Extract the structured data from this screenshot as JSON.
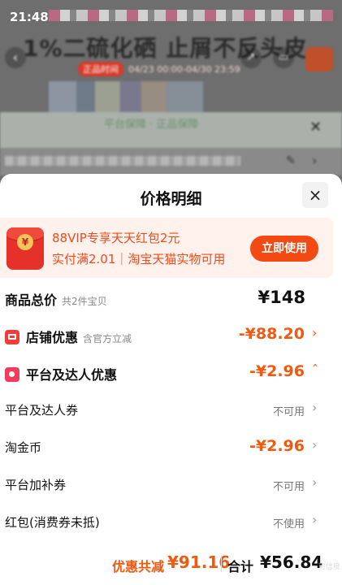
{
  "status_bar": {
    "time": "21:48"
  },
  "background": {
    "title": "1%二硫化硒 止屑不反头皮",
    "promo_pill": "正品时间",
    "promo_dates": "04/23 00:00-04/30 23:59",
    "guarantee_text": "平台保障 · 正品保障"
  },
  "sheet": {
    "title": "价格明细",
    "close_glyph": "×"
  },
  "vip": {
    "coin_glyph": "¥",
    "line1": "88VIP专享天天红包2元",
    "line2": "实付满2.01｜淘宝天猫实物可用",
    "button": "立即使用"
  },
  "rows": [
    {
      "label": "商品总价",
      "sub": "共2件宝贝",
      "value": "¥148",
      "chevron": ""
    },
    {
      "label": "店铺优惠",
      "sub": "含官方立减",
      "value": "-¥88.20",
      "chevron": "›"
    },
    {
      "label": "平台及达人优惠",
      "sub": "",
      "value": "-¥2.96",
      "chevron": "ˆ"
    },
    {
      "label": "平台及达人券",
      "sub": "",
      "value": "不可用",
      "chevron": "›"
    },
    {
      "label": "淘金币",
      "sub": "",
      "value": "-¥2.96",
      "chevron": "›"
    },
    {
      "label": "平台加补券",
      "sub": "",
      "value": "不可用",
      "chevron": "›"
    },
    {
      "label": "红包(消费券未抵)",
      "sub": "",
      "value": "不使用",
      "chevron": "›"
    }
  ],
  "footer": {
    "discount_label": "优惠共减",
    "discount_value": "¥91.16",
    "total_label": "合计",
    "total_value": "¥56.84",
    "watermark": "可信度"
  },
  "colors": {
    "accent": "#f0590f",
    "vip_text": "#f0491a",
    "button": "#f24a12",
    "vip_bg": "#fff2ec"
  }
}
